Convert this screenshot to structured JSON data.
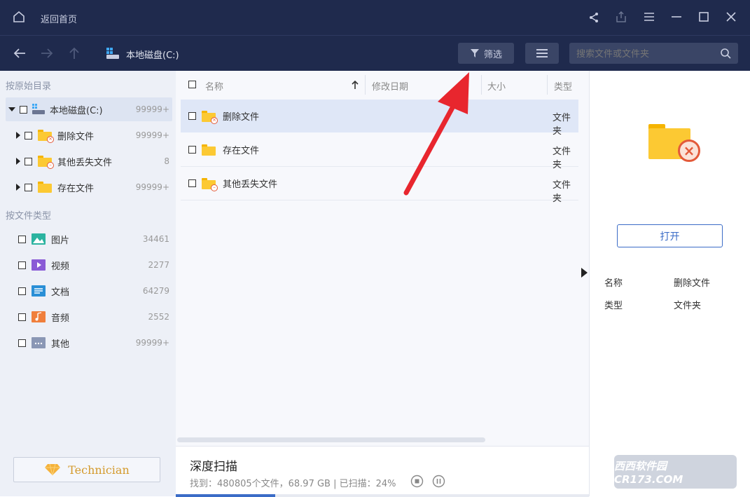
{
  "titlebar": {
    "back_home": "返回首页"
  },
  "navbar": {
    "drive_label": "本地磁盘(C:)",
    "filter_label": "筛选",
    "search_placeholder": "搜索文件或文件夹"
  },
  "sidebar": {
    "section1": "按原始目录",
    "tree": [
      {
        "label": "本地磁盘(C:)",
        "count": "99999+"
      },
      {
        "label": "删除文件",
        "count": "99999+"
      },
      {
        "label": "其他丢失文件",
        "count": "8"
      },
      {
        "label": "存在文件",
        "count": "99999+"
      }
    ],
    "section2": "按文件类型",
    "types": [
      {
        "label": "图片",
        "count": "34461",
        "color": "#2bb3a0"
      },
      {
        "label": "视频",
        "count": "2277",
        "color": "#8a5bd6"
      },
      {
        "label": "文档",
        "count": "64279",
        "color": "#2a8fd6"
      },
      {
        "label": "音频",
        "count": "2552",
        "color": "#f07f3c"
      },
      {
        "label": "其他",
        "count": "99999+",
        "color": "#8a97b5"
      }
    ],
    "technician": "Technician"
  },
  "table": {
    "columns": {
      "name": "名称",
      "modified": "修改日期",
      "size": "大小",
      "type": "类型"
    },
    "rows": [
      {
        "name": "删除文件",
        "type": "文件夹"
      },
      {
        "name": "存在文件",
        "type": "文件夹"
      },
      {
        "name": "其他丢失文件",
        "type": "文件夹"
      }
    ]
  },
  "details": {
    "open_button": "打开",
    "name_key": "名称",
    "name_val": "删除文件",
    "type_key": "类型",
    "type_val": "文件夹"
  },
  "scan": {
    "title": "深度扫描",
    "status": "找到：480805个文件，68.97 GB | 已扫描：24%",
    "progress": 0.24
  },
  "watermark": "西西软件园 CR173.COM",
  "colors": {
    "dark_bar": "#1f2a4d",
    "accent": "#3b6cc7",
    "arrow": "#e8262e"
  }
}
